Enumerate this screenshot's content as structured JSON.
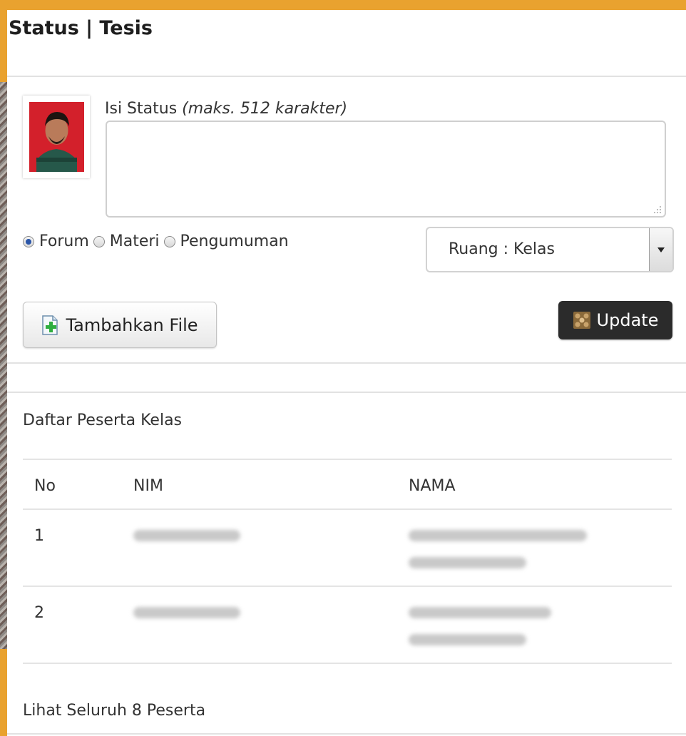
{
  "page": {
    "title": "Status | Tesis"
  },
  "status_form": {
    "label": "Isi Status",
    "label_hint": "(maks. 512 karakter)",
    "textarea_value": "",
    "post_types": [
      {
        "label": "Forum",
        "checked": true
      },
      {
        "label": "Materi",
        "checked": false
      },
      {
        "label": "Pengumuman",
        "checked": false
      }
    ],
    "room_select": {
      "selected": "Ruang : Kelas"
    },
    "add_file_label": "Tambahkan File",
    "update_label": "Update"
  },
  "participants": {
    "title": "Daftar Peserta Kelas",
    "columns": [
      "No",
      "NIM",
      "NAMA"
    ],
    "rows": [
      {
        "no": "1"
      },
      {
        "no": "2"
      }
    ],
    "see_all_label": "Lihat Seluruh 8 Peserta"
  },
  "colors": {
    "frame": "#e9a22f",
    "update_button": "#2b2b2b",
    "radio_checked": "#2a55a8"
  }
}
